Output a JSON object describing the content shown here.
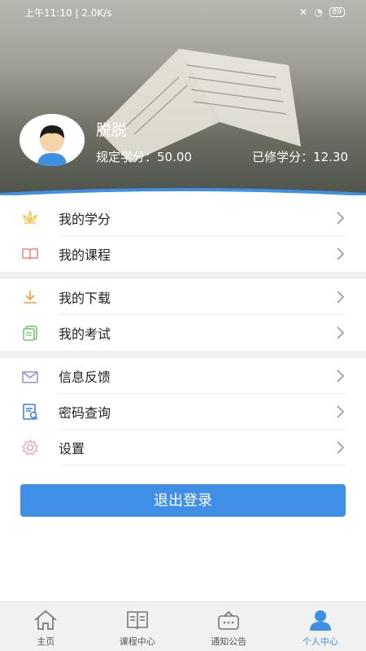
{
  "status_bar": {
    "time": "上午11:10",
    "speed": "2.0K/s",
    "battery": "89"
  },
  "profile": {
    "name": "脱脱",
    "required_credits_label": "规定学分：",
    "required_credits": "50.00",
    "earned_credits_label": "已修学分：",
    "earned_credits": "12.30"
  },
  "menu": {
    "group1": [
      {
        "label": "我的学分",
        "icon": "lotus-icon",
        "color": "#f2c84b"
      },
      {
        "label": "我的课程",
        "icon": "book-icon",
        "color": "#ef8a7b"
      }
    ],
    "group2": [
      {
        "label": "我的下载",
        "icon": "download-icon",
        "color": "#f0a03a"
      },
      {
        "label": "我的考试",
        "icon": "exam-icon",
        "color": "#73c36a"
      }
    ],
    "group3": [
      {
        "label": "信息反馈",
        "icon": "mail-icon",
        "color": "#9b88d6"
      },
      {
        "label": "密码查询",
        "icon": "document-search-icon",
        "color": "#3f7fd9"
      },
      {
        "label": "设置",
        "icon": "gear-icon",
        "color": "#e6a0c4"
      }
    ]
  },
  "logout_label": "退出登录",
  "tabs": [
    {
      "label": "主页",
      "icon": "home-icon",
      "active": false
    },
    {
      "label": "课程中心",
      "icon": "open-book-icon",
      "active": false
    },
    {
      "label": "通知公告",
      "icon": "notice-icon",
      "active": false
    },
    {
      "label": "个人中心",
      "icon": "person-icon",
      "active": true
    }
  ],
  "colors": {
    "accent": "#3f8fe6",
    "divider": "#eef0f1"
  }
}
